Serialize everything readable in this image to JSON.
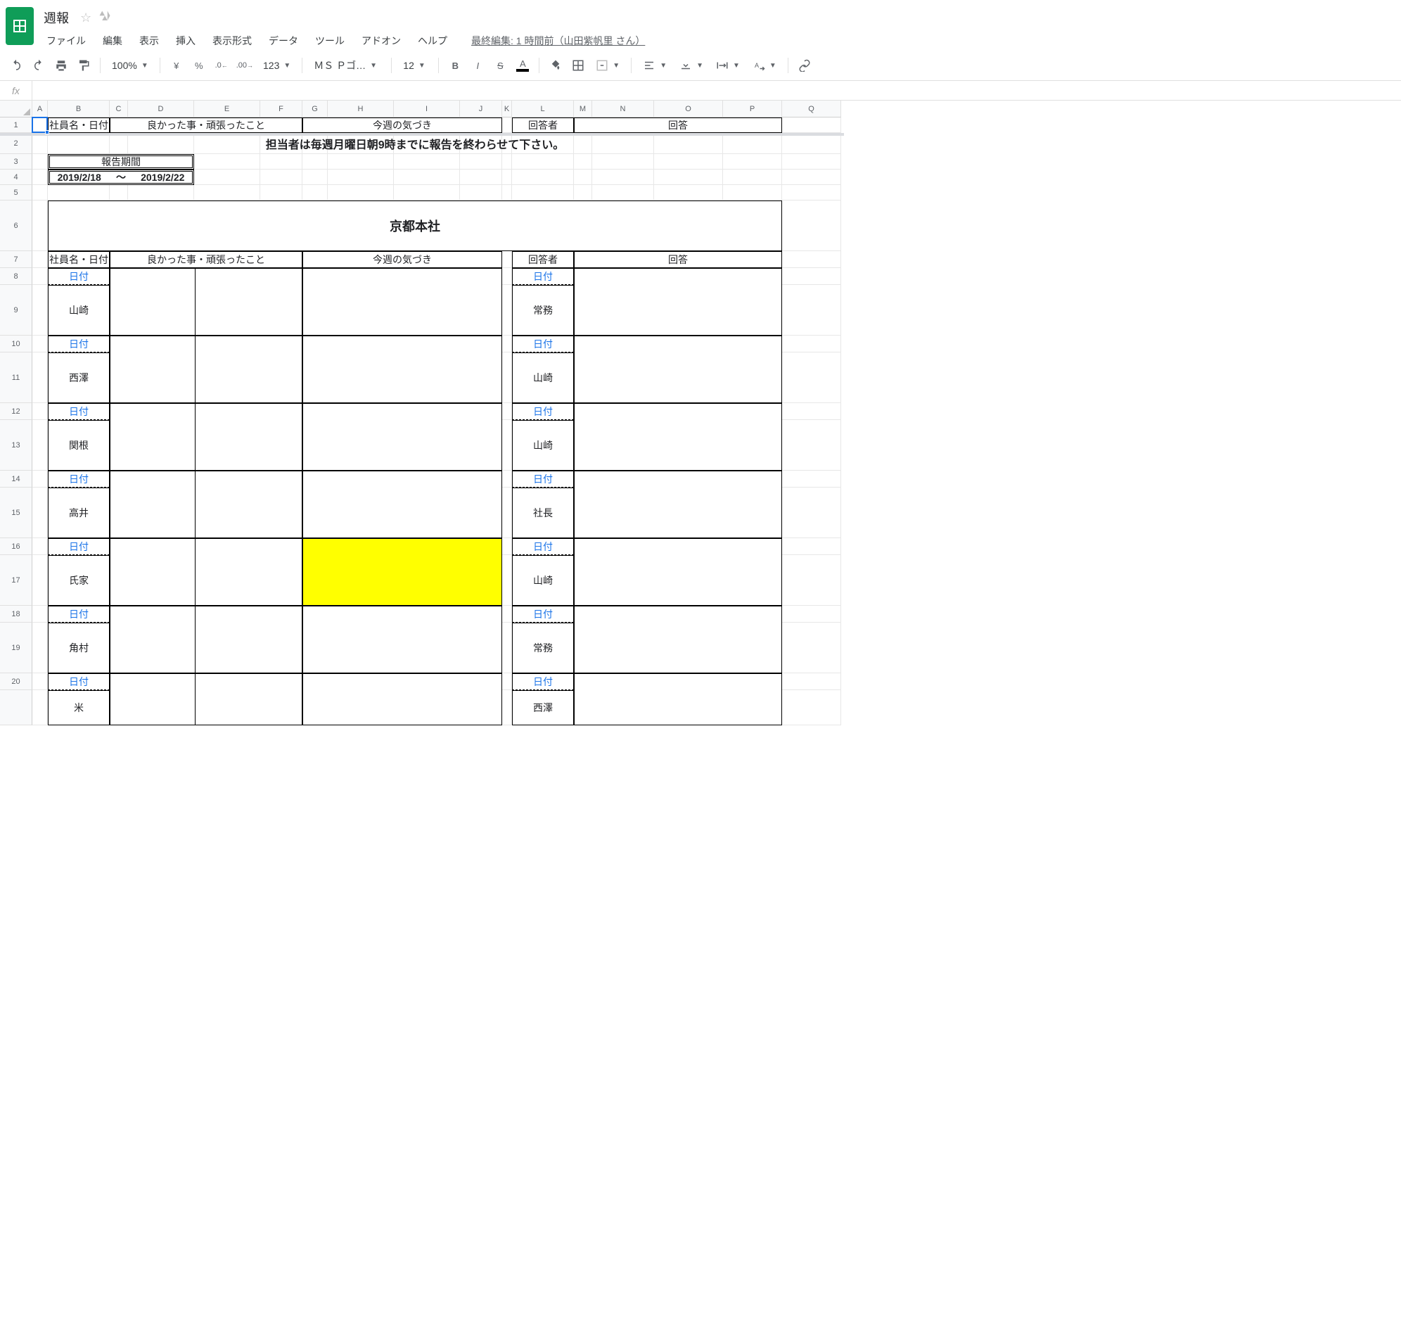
{
  "header": {
    "title": "週報",
    "menus": [
      "ファイル",
      "編集",
      "表示",
      "挿入",
      "表示形式",
      "データ",
      "ツール",
      "アドオン",
      "ヘルプ"
    ],
    "last_edit": "最終編集: 1 時間前（山田紫帆里 さん）"
  },
  "toolbar": {
    "zoom": "100%",
    "currency": "¥",
    "percent": "%",
    "dec_dec": ".0",
    "dec_inc": ".00",
    "num_fmt": "123",
    "font": "ＭＳ Ｐゴ…",
    "size": "12"
  },
  "fx": {
    "value": ""
  },
  "columns": [
    "A",
    "B",
    "C",
    "D",
    "E",
    "F",
    "G",
    "H",
    "I",
    "J",
    "K",
    "L",
    "M",
    "N",
    "O",
    "P",
    "Q"
  ],
  "rowlabels": [
    "1",
    "2",
    "3",
    "4",
    "5",
    "6",
    "7",
    "8",
    "9",
    "10",
    "11",
    "12",
    "13",
    "14",
    "15",
    "16",
    "17",
    "18",
    "19",
    "20",
    ""
  ],
  "frozen_header": {
    "c1": "社員名・日付",
    "c2": "良かった事・頑張ったこと",
    "c3": "今週の気づき",
    "c4": "回答者",
    "c5": "回答"
  },
  "notice": "担当者は毎週月曜日朝9時までに報告を終わらせて下さい。",
  "period": {
    "label": "報告期間",
    "from": "2019/2/18",
    "tilde": "〜",
    "to": "2019/2/22"
  },
  "section_title": "京都本社",
  "table_header": {
    "c1": "社員名・日付",
    "c2": "良かった事・頑張ったこと",
    "c3": "今週の気づき",
    "c4": "回答者",
    "c5": "回答"
  },
  "entries": [
    {
      "date": "日付",
      "name": "山崎",
      "respDate": "日付",
      "responder": "常務",
      "highlight": false
    },
    {
      "date": "日付",
      "name": "西澤",
      "respDate": "日付",
      "responder": "山崎",
      "highlight": false
    },
    {
      "date": "日付",
      "name": "関根",
      "respDate": "日付",
      "responder": "山崎",
      "highlight": false
    },
    {
      "date": "日付",
      "name": "高井",
      "respDate": "日付",
      "responder": "社長",
      "highlight": false
    },
    {
      "date": "日付",
      "name": "氏家",
      "respDate": "日付",
      "responder": "山崎",
      "highlight": true
    },
    {
      "date": "日付",
      "name": "角村",
      "respDate": "日付",
      "responder": "常務",
      "highlight": false
    },
    {
      "date": "日付",
      "name": "米",
      "respDate": "日付",
      "responder": "西澤",
      "highlight": false
    }
  ]
}
